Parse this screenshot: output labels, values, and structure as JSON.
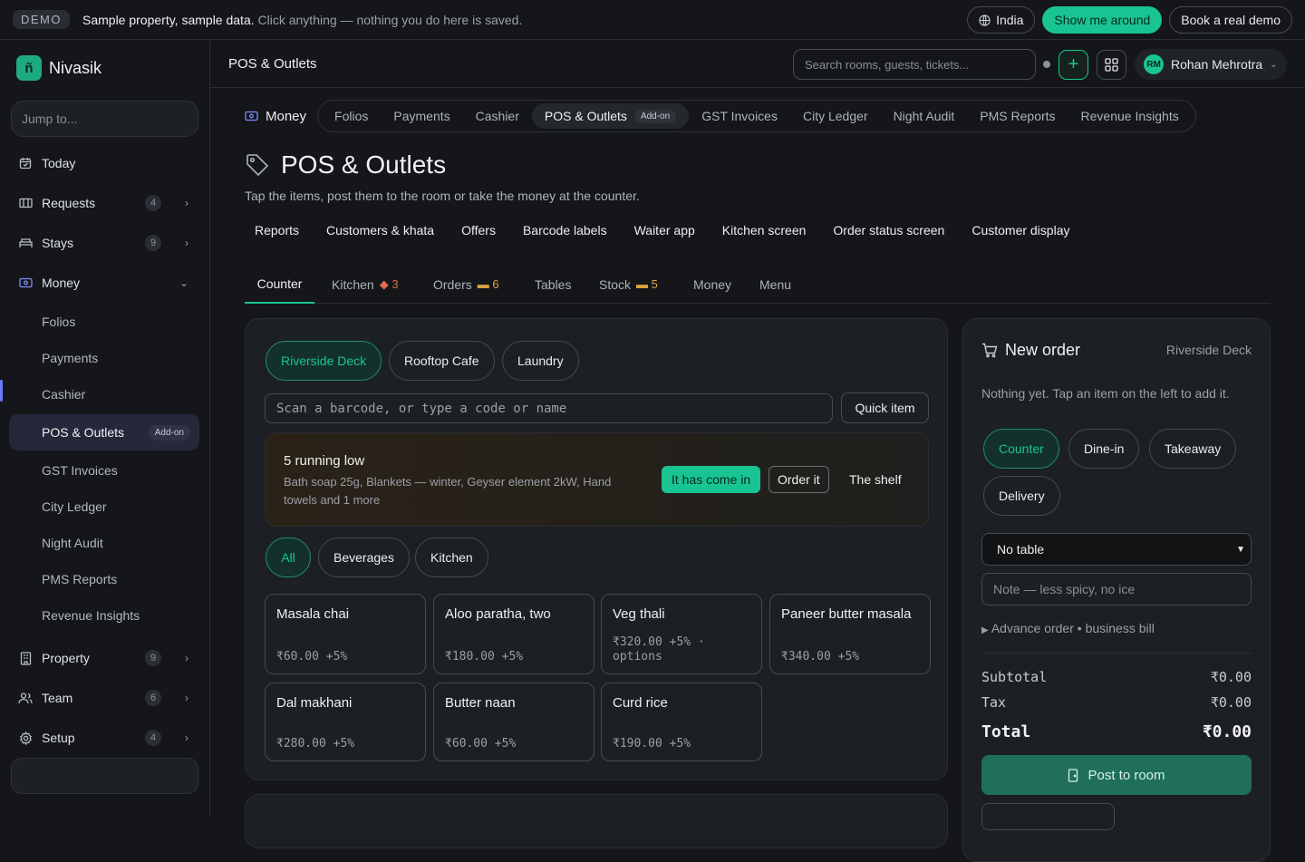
{
  "demo_bar": {
    "badge": "DEMO",
    "strong": "Sample property, sample data.",
    "text": " Click anything — nothing you do here is saved.",
    "region": "India",
    "tour": "Show me around",
    "book": "Book a real demo"
  },
  "sidebar": {
    "brand": "Nivasik",
    "logo_letter": "ñ",
    "jump_placeholder": "Jump to...",
    "items": [
      {
        "label": "Today"
      },
      {
        "label": "Requests",
        "count": "4"
      },
      {
        "label": "Stays",
        "count": "9"
      },
      {
        "label": "Money"
      },
      {
        "label": "Property",
        "count": "9"
      },
      {
        "label": "Team",
        "count": "6"
      },
      {
        "label": "Setup",
        "count": "4"
      }
    ],
    "money_sub": [
      "Folios",
      "Payments",
      "Cashier",
      "POS & Outlets",
      "GST Invoices",
      "City Ledger",
      "Night Audit",
      "PMS Reports",
      "Revenue Insights"
    ],
    "addon": "Add-on"
  },
  "header": {
    "crumb": "POS & Outlets",
    "search_placeholder": "Search rooms, guests, tickets...",
    "user_initials": "RM",
    "user_name": "Rohan Mehrotra"
  },
  "money_tabs": {
    "label": "Money",
    "tabs": [
      "Folios",
      "Payments",
      "Cashier",
      "POS & Outlets",
      "GST Invoices",
      "City Ledger",
      "Night Audit",
      "PMS Reports",
      "Revenue Insights"
    ],
    "addon": "Add-on"
  },
  "page": {
    "title": "POS & Outlets",
    "subtitle": "Tap the items, post them to the room or take the money at the counter.",
    "links": [
      "Reports",
      "Customers & khata",
      "Offers",
      "Barcode labels",
      "Waiter app",
      "Kitchen screen",
      "Order status screen",
      "Customer display"
    ],
    "subtabs": [
      {
        "label": "Counter"
      },
      {
        "label": "Kitchen",
        "badge": "3",
        "badge_color": "#e0694f"
      },
      {
        "label": "Orders",
        "badge": "6",
        "badge_color": "#d9a441"
      },
      {
        "label": "Tables"
      },
      {
        "label": "Stock",
        "badge": "5",
        "badge_color": "#d9a441"
      },
      {
        "label": "Money"
      },
      {
        "label": "Menu"
      }
    ]
  },
  "counter": {
    "outlets": [
      "Riverside Deck",
      "Rooftop Cafe",
      "Laundry"
    ],
    "scan_placeholder": "Scan a barcode, or type a code or name",
    "quick_item": "Quick item",
    "low_stock": {
      "heading": "5 running low",
      "detail": "Bath soap 25g, Blankets — winter, Geyser element 2kW, Hand towels and 1 more",
      "came_in": "It has come in",
      "order_it": "Order it",
      "shelf": "The shelf"
    },
    "categories": [
      "All",
      "Beverages",
      "Kitchen"
    ],
    "items": [
      {
        "name": "Masala chai",
        "price": "₹60.00 +5%"
      },
      {
        "name": "Aloo paratha, two",
        "price": "₹180.00 +5%"
      },
      {
        "name": "Veg thali",
        "price": "₹320.00 +5% · options"
      },
      {
        "name": "Paneer butter masala",
        "price": "₹340.00 +5%"
      },
      {
        "name": "Dal makhani",
        "price": "₹280.00 +5%"
      },
      {
        "name": "Butter naan",
        "price": "₹60.00 +5%"
      },
      {
        "name": "Curd rice",
        "price": "₹190.00 +5%"
      }
    ]
  },
  "order": {
    "title": "New order",
    "outlet": "Riverside Deck",
    "empty": "Nothing yet. Tap an item on the left to add it.",
    "modes": [
      "Counter",
      "Dine-in",
      "Takeaway",
      "Delivery"
    ],
    "table": "No table",
    "note_placeholder": "Note — less spicy, no ice",
    "advance": "Advance order • business bill",
    "subtotal_label": "Subtotal",
    "subtotal": "₹0.00",
    "tax_label": "Tax",
    "tax": "₹0.00",
    "total_label": "Total",
    "total": "₹0.00",
    "post": "Post to room"
  },
  "colors": {
    "accent": "#19c493",
    "active_nav": "#6b7cff"
  }
}
